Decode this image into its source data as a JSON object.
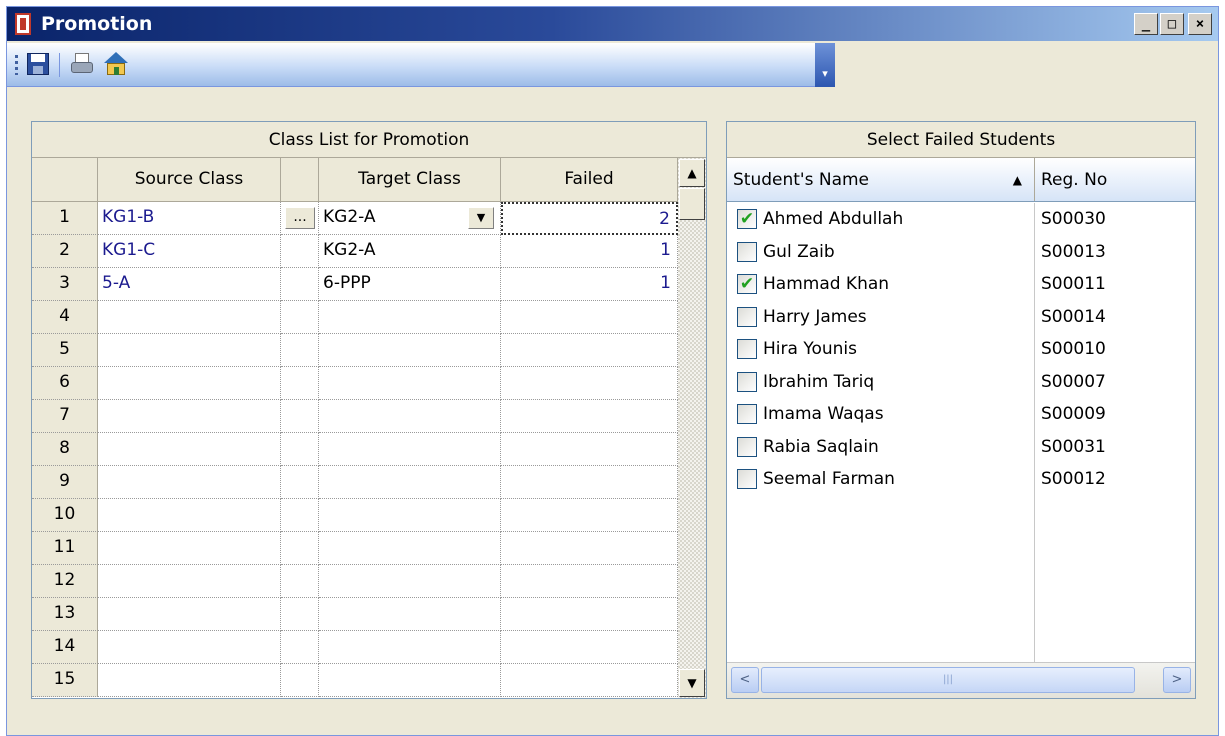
{
  "window": {
    "title": "Promotion",
    "controls": {
      "minimize": "_",
      "maximize": "□",
      "close": "×"
    }
  },
  "toolbar": {
    "items": [
      {
        "icon": "save-icon"
      },
      {
        "icon": "print-icon"
      },
      {
        "icon": "home-icon"
      }
    ],
    "overflow_glyph": "▾"
  },
  "class_grid": {
    "caption": "Class List for Promotion",
    "columns": [
      "Source Class",
      "",
      "Target Class",
      "Failed"
    ],
    "rows": [
      {
        "num": "1",
        "source": "KG1-B",
        "target": "KG2-A",
        "failed": "2"
      },
      {
        "num": "2",
        "source": "KG1-C",
        "target": "KG2-A",
        "failed": "1"
      },
      {
        "num": "3",
        "source": "5-A",
        "target": "6-PPP",
        "failed": "1"
      },
      {
        "num": "4",
        "source": "",
        "target": "",
        "failed": ""
      },
      {
        "num": "5",
        "source": "",
        "target": "",
        "failed": ""
      },
      {
        "num": "6",
        "source": "",
        "target": "",
        "failed": ""
      },
      {
        "num": "7",
        "source": "",
        "target": "",
        "failed": ""
      },
      {
        "num": "8",
        "source": "",
        "target": "",
        "failed": ""
      },
      {
        "num": "9",
        "source": "",
        "target": "",
        "failed": ""
      },
      {
        "num": "10",
        "source": "",
        "target": "",
        "failed": ""
      },
      {
        "num": "11",
        "source": "",
        "target": "",
        "failed": ""
      },
      {
        "num": "12",
        "source": "",
        "target": "",
        "failed": ""
      },
      {
        "num": "13",
        "source": "",
        "target": "",
        "failed": ""
      },
      {
        "num": "14",
        "source": "",
        "target": "",
        "failed": ""
      },
      {
        "num": "15",
        "source": "",
        "target": "",
        "failed": ""
      }
    ],
    "ellipsis_label": "...",
    "combo_arrow": "▼",
    "scroll_up": "▲",
    "scroll_down": "▼"
  },
  "failed_students": {
    "caption": "Select Failed Students",
    "columns": {
      "name": "Student's Name",
      "reg": "Reg. No"
    },
    "sort_indicator": "▲",
    "rows": [
      {
        "name": "Ahmed Abdullah",
        "reg": "S00030",
        "checked": true
      },
      {
        "name": "Gul Zaib",
        "reg": "S00013",
        "checked": false
      },
      {
        "name": "Hammad Khan",
        "reg": "S00011",
        "checked": true
      },
      {
        "name": "Harry James",
        "reg": "S00014",
        "checked": false
      },
      {
        "name": "Hira Younis",
        "reg": "S00010",
        "checked": false
      },
      {
        "name": "Ibrahim Tariq",
        "reg": "S00007",
        "checked": false
      },
      {
        "name": "Imama Waqas",
        "reg": "S00009",
        "checked": false
      },
      {
        "name": "Rabia Saqlain",
        "reg": "S00031",
        "checked": false
      },
      {
        "name": "Seemal Farman",
        "reg": "S00012",
        "checked": false
      }
    ],
    "check_glyph": "✔",
    "hscroll": {
      "left": "<",
      "right": ">",
      "grip": "|||"
    }
  }
}
